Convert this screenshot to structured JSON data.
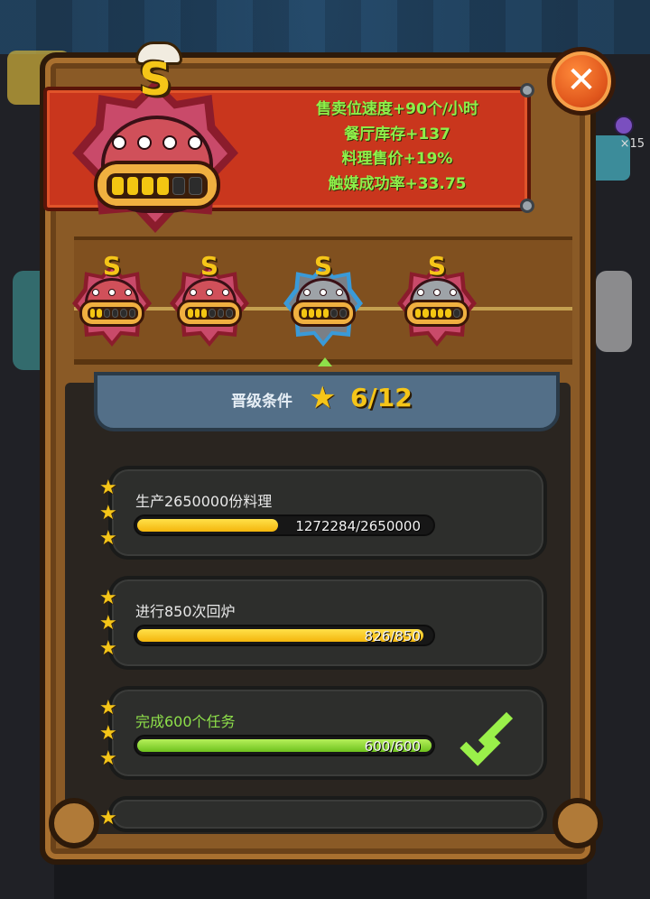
{
  "banner": {
    "lines": [
      "售卖位速度+90个/小时",
      "餐厅库存+137",
      "料理售价+19%",
      "触媒成功率+33.75"
    ]
  },
  "badge_big": {
    "rank": "S",
    "level_filled": 4,
    "level_total": 6
  },
  "potion": {
    "count": "×15"
  },
  "levels": [
    {
      "rank": "S",
      "style": "red",
      "filled": 2
    },
    {
      "rank": "S",
      "style": "red",
      "filled": 3
    },
    {
      "rank": "S",
      "style": "grey",
      "filled": 4,
      "selected": true
    },
    {
      "rank": "S",
      "style": "grey",
      "filled": 5
    }
  ],
  "requirement": {
    "label": "晋级条件",
    "count": "6/12"
  },
  "tasks": [
    {
      "title": "生产2650000份料理",
      "progress": "1272284/2650000",
      "fraction": 0.48,
      "stars": 3,
      "done": false
    },
    {
      "title": "进行850次回炉",
      "progress": "826/850",
      "fraction": 0.972,
      "stars": 3,
      "done": false
    },
    {
      "title": "完成600个任务",
      "progress": "600/600",
      "fraction": 1.0,
      "stars": 3,
      "done": true
    }
  ],
  "colors": {
    "accent_green": "#8ee04a",
    "accent_yellow": "#f5c518",
    "banner_red": "#c9361d"
  },
  "icons": {
    "close": "close-icon",
    "star": "star-icon",
    "check": "checkmark-icon",
    "potion": "potion-icon"
  }
}
